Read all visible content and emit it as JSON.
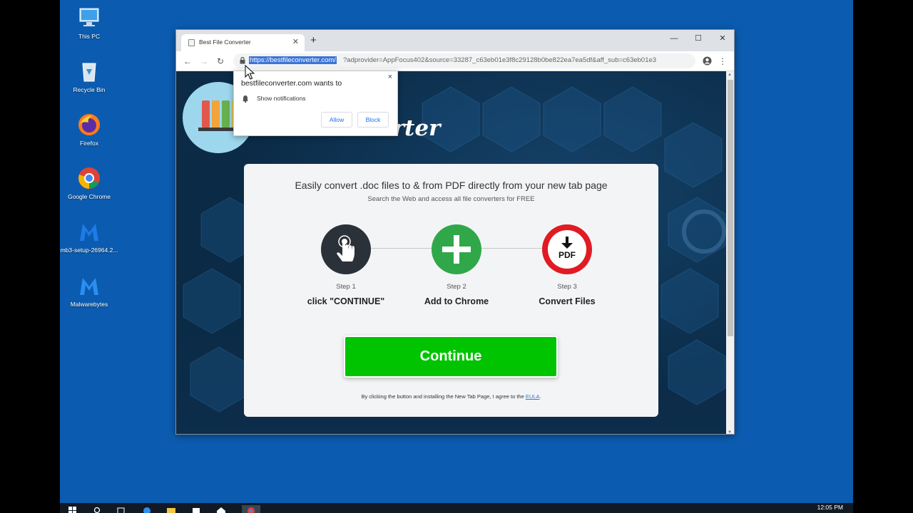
{
  "desktop": {
    "icons": [
      {
        "label": "This PC"
      },
      {
        "label": "Recycle Bin"
      },
      {
        "label": "Firefox"
      },
      {
        "label": "Google Chrome"
      },
      {
        "label": "mb3-setup-26964.2..."
      },
      {
        "label": "Malwarebytes"
      }
    ]
  },
  "taskbar": {
    "clock": "12:05 PM"
  },
  "browser": {
    "tab_title": "Best File Converter",
    "new_tab": "+",
    "url_host": "https://bestfileconverter.com/",
    "url_rest": "?adprovider=AppFocus402&source=33287_c63eb01e3f8c29128b0be822ea7ea5df&aff_sub=c63eb01e3",
    "nav": {
      "back": "←",
      "forward": "→",
      "reload": "↻"
    },
    "window": {
      "minimize": "—",
      "maximize": "☐",
      "close": "✕"
    }
  },
  "page": {
    "brand_text": "File Converter",
    "headline": "Easily convert .doc files to & from PDF directly from your new tab page",
    "subline": "Search the Web and access all file converters for FREE",
    "steps": [
      {
        "number": "Step 1",
        "title": "click \"CONTINUE\""
      },
      {
        "number": "Step 2",
        "title": "Add to Chrome"
      },
      {
        "number": "Step 3",
        "title": "Convert Files"
      }
    ],
    "pdf_label": "PDF",
    "continue_label": "Continue",
    "legal_text": "By clicking the button and installing the New Tab Page, I agree to the ",
    "legal_link": "EULA",
    "legal_end": "."
  },
  "popup": {
    "title": "bestfileconverter.com wants to",
    "message": "Show notifications",
    "allow": "Allow",
    "block": "Block",
    "close": "×"
  },
  "colors": {
    "desktop": "#0b5cb0",
    "continue_green": "#00c400",
    "step2_green": "#30a84a",
    "step3_red": "#e01b24",
    "step1_dark": "#2b3138"
  }
}
